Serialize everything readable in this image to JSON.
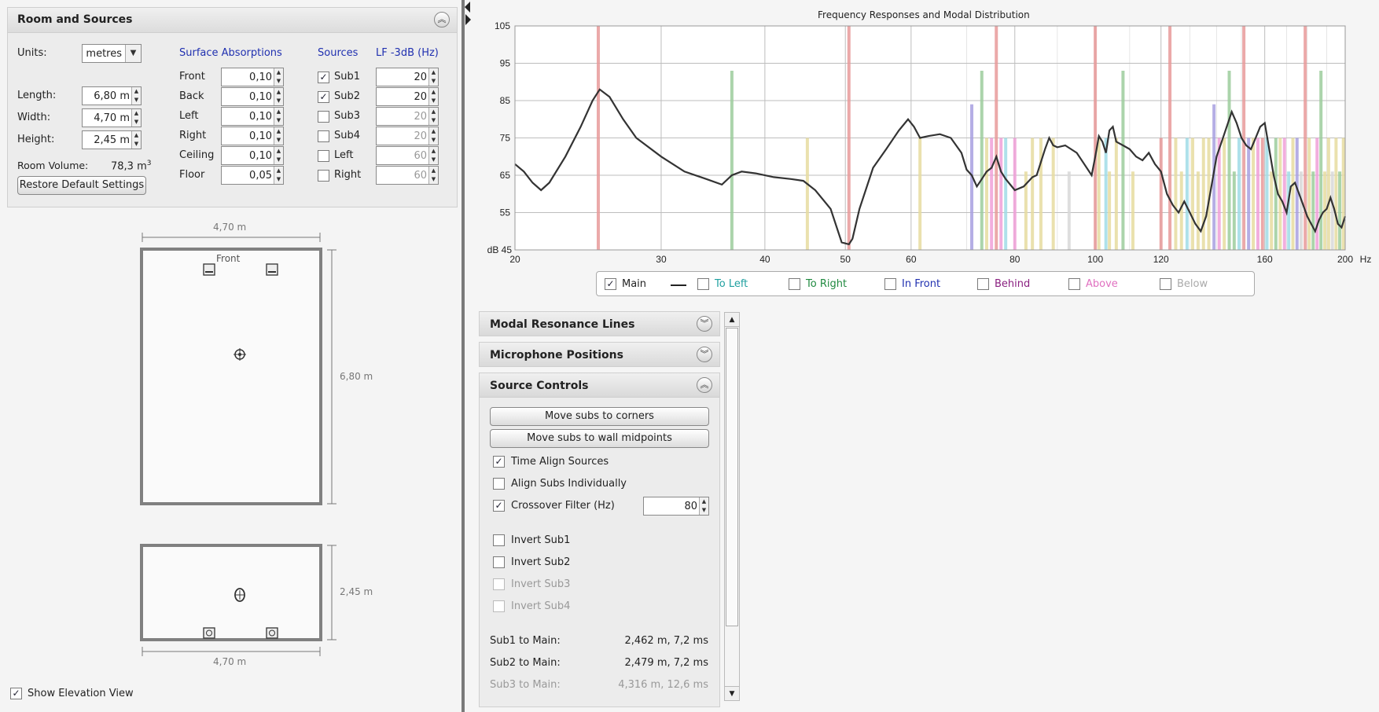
{
  "room_panel": {
    "title": "Room and Sources",
    "units_label": "Units:",
    "units_value": "metres",
    "length_label": "Length:",
    "length_value": "6,80 m",
    "width_label": "Width:",
    "width_value": "4,70 m",
    "height_label": "Height:",
    "height_value": "2,45 m",
    "volume_label": "Room Volume:",
    "volume_value": "78,3 m",
    "volume_unit_sup": "3",
    "restore_button": "Restore Default Settings",
    "surface_header": "Surface Absorptions",
    "surfaces": [
      {
        "label": "Front",
        "value": "0,10"
      },
      {
        "label": "Back",
        "value": "0,10"
      },
      {
        "label": "Left",
        "value": "0,10"
      },
      {
        "label": "Right",
        "value": "0,10"
      },
      {
        "label": "Ceiling",
        "value": "0,10"
      },
      {
        "label": "Floor",
        "value": "0,05"
      }
    ],
    "sources_header": "Sources",
    "lf_header": "LF -3dB (Hz)",
    "sources": [
      {
        "label": "Sub1",
        "checked": true,
        "lf": "20"
      },
      {
        "label": "Sub2",
        "checked": true,
        "lf": "20"
      },
      {
        "label": "Sub3",
        "checked": false,
        "lf": "20"
      },
      {
        "label": "Sub4",
        "checked": false,
        "lf": "20"
      },
      {
        "label": "Left",
        "checked": false,
        "lf": "60"
      },
      {
        "label": "Right",
        "checked": false,
        "lf": "60"
      }
    ]
  },
  "plan_view": {
    "width_dim": "4,70 m",
    "length_dim": "6,80 m",
    "front_label": "Front"
  },
  "elevation_view": {
    "height_dim": "2,45 m",
    "width_dim": "4,70 m"
  },
  "show_elevation": {
    "label": "Show Elevation View",
    "checked": true
  },
  "chart": {
    "title": "Frequency Responses and Modal Distribution",
    "y_unit": "dB",
    "x_unit": "Hz",
    "y_ticks": [
      "105",
      "95",
      "85",
      "75",
      "65",
      "55",
      "45"
    ],
    "x_ticks": [
      "20",
      "30",
      "40",
      "50",
      "60",
      "80",
      "100",
      "120",
      "160",
      "200"
    ]
  },
  "chart_data": {
    "type": "line",
    "title": "Frequency Responses and Modal Distribution",
    "xlabel": "Hz",
    "ylabel": "dB",
    "xscale": "log",
    "xlim": [
      20,
      200
    ],
    "ylim": [
      45,
      105
    ],
    "grid": true,
    "series": [
      {
        "name": "Main",
        "color": "#333333",
        "x": [
          20,
          20.5,
          21,
          21.5,
          22,
          23,
          24,
          24.8,
          25.3,
          26,
          27,
          28,
          30,
          32,
          34,
          35.5,
          36.5,
          37.5,
          39,
          41,
          43,
          44.5,
          46,
          48,
          49.5,
          50.5,
          51,
          52,
          54,
          56,
          58,
          59.5,
          60.5,
          61.5,
          63,
          65,
          67,
          69,
          70,
          71,
          72,
          73,
          74,
          75,
          76,
          77,
          78,
          80,
          82,
          84,
          85,
          86,
          87,
          88,
          89,
          90,
          92,
          95,
          97,
          99,
          100,
          101,
          102,
          103,
          104,
          105,
          106,
          108,
          110,
          112,
          114,
          116,
          118,
          120,
          122,
          124,
          126,
          128,
          130,
          132,
          134,
          136,
          138,
          140,
          142,
          144,
          146,
          148,
          150,
          152,
          154,
          156,
          158,
          160,
          162,
          164,
          166,
          168,
          170,
          172,
          174,
          176,
          178,
          180,
          182,
          184,
          186,
          188,
          190,
          192,
          194,
          196,
          198,
          200
        ],
        "y": [
          68,
          66,
          63,
          61,
          63,
          70,
          78,
          85,
          88,
          86,
          80,
          75,
          70,
          66,
          64,
          62.5,
          65,
          66,
          65.5,
          64.5,
          64,
          63.5,
          61,
          56,
          47,
          46.5,
          48,
          56,
          67,
          72,
          77,
          80,
          78,
          75,
          75.5,
          76,
          75,
          71,
          66.5,
          65,
          62,
          64,
          66,
          67,
          70,
          66,
          64,
          61,
          62,
          64.5,
          65,
          68.5,
          72,
          75,
          73,
          72.5,
          73,
          71,
          68,
          65,
          70,
          75.5,
          74,
          71,
          77,
          78,
          74,
          73,
          72,
          70,
          69,
          71,
          68,
          66,
          60,
          57,
          55,
          58,
          55,
          52,
          50,
          54,
          62,
          70,
          74,
          78,
          82,
          79,
          75,
          73,
          72,
          75,
          78,
          79,
          72,
          65,
          60,
          58,
          55,
          62,
          63,
          60,
          57,
          54,
          52,
          50,
          53,
          55,
          56,
          59,
          56,
          52,
          51,
          54
        ]
      }
    ]
  },
  "legend": [
    {
      "label": "Main",
      "checked": true,
      "color": "#222222"
    },
    {
      "label": "To Left",
      "checked": false,
      "color": "#20a0a0"
    },
    {
      "label": "To Right",
      "checked": false,
      "color": "#208a40"
    },
    {
      "label": "In Front",
      "checked": false,
      "color": "#2030b0"
    },
    {
      "label": "Behind",
      "checked": false,
      "color": "#8a2080"
    },
    {
      "label": "Above",
      "checked": false,
      "color": "#e070c0"
    },
    {
      "label": "Below",
      "checked": false,
      "color": "#aaaaaa"
    }
  ],
  "accordion": {
    "modal_lines": "Modal Resonance Lines",
    "mic_positions": "Microphone Positions",
    "source_controls": "Source Controls"
  },
  "source_controls": {
    "move_corners": "Move subs to corners",
    "move_midpoints": "Move subs to wall midpoints",
    "time_align": {
      "label": "Time Align Sources",
      "checked": true
    },
    "align_individually": {
      "label": "Align Subs Individually",
      "checked": false
    },
    "crossover": {
      "label": "Crossover Filter (Hz)",
      "checked": true,
      "value": "80"
    },
    "invert": [
      {
        "label": "Invert Sub1",
        "enabled": true
      },
      {
        "label": "Invert Sub2",
        "enabled": true
      },
      {
        "label": "Invert Sub3",
        "enabled": false
      },
      {
        "label": "Invert Sub4",
        "enabled": false
      }
    ],
    "distances": [
      {
        "label": "Sub1 to Main:",
        "value": "2,462 m, 7,2 ms",
        "enabled": true
      },
      {
        "label": "Sub2 to Main:",
        "value": "2,479 m, 7,2 ms",
        "enabled": true
      },
      {
        "label": "Sub3 to Main:",
        "value": "4,316 m, 12,6 ms",
        "enabled": false
      }
    ]
  }
}
